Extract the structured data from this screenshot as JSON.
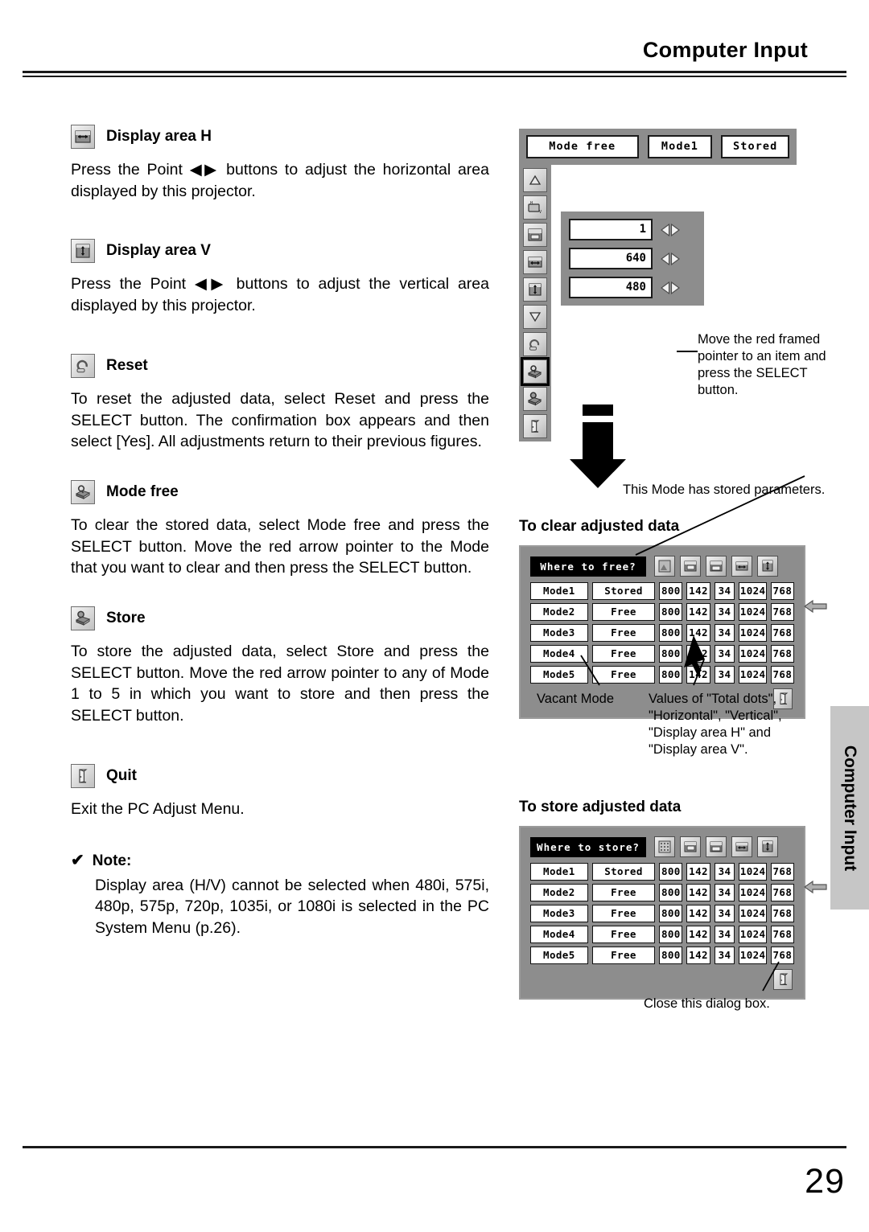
{
  "header": {
    "title": "Computer Input"
  },
  "footer": {
    "page_number": "29"
  },
  "side_tab": {
    "label": "Computer Input"
  },
  "sections": [
    {
      "icon": "display-area-h-icon",
      "title": "Display area H",
      "body": "Press the Point ◀▶ buttons to adjust the horizontal area displayed by this projector."
    },
    {
      "icon": "display-area-v-icon",
      "title": "Display area V",
      "body": "Press the Point ◀▶ buttons to adjust the vertical area displayed by this projector."
    },
    {
      "icon": "reset-icon",
      "title": "Reset",
      "body": "To reset the adjusted data, select Reset and press the SELECT button.  The confirmation box appears and then select [Yes].  All adjustments return to their previous figures."
    },
    {
      "icon": "mode-free-icon",
      "title": "Mode free",
      "body": "To clear the stored data, select Mode free and press the SELECT button.  Move the red arrow pointer to the Mode that you want to clear and then press the SELECT button."
    },
    {
      "icon": "store-icon",
      "title": "Store",
      "body": "To store the adjusted data, select Store and press the SELECT button.  Move the red arrow pointer to any of Mode 1 to 5 in which you want to store and then press the SELECT button."
    },
    {
      "icon": "quit-icon",
      "title": "Quit",
      "body": "Exit the PC Adjust Menu."
    }
  ],
  "note": {
    "check_glyph": "✔",
    "title": "Note:",
    "body": "Display area (H/V) cannot be selected when 480i, 575i, 480p, 575p, 720p, 1035i, or 1080i is selected in the PC System Menu (p.26)."
  },
  "osd": {
    "top_fields": [
      {
        "name": "mode-free-field",
        "value": "Mode free"
      },
      {
        "name": "mode-number-field",
        "value": "Mode1"
      },
      {
        "name": "stored-state-field",
        "value": "Stored"
      }
    ],
    "rail_icons": [
      "fine-sync-icon",
      "total-dots-icon",
      "horizontal-icon",
      "vertical-icon",
      "display-area-h-icon",
      "display-area-v-icon",
      "reset-icon",
      "mode-free-icon",
      "store-icon",
      "quit-icon"
    ],
    "selected_rail_index": 7,
    "values": [
      {
        "name": "mode-value",
        "value": "1"
      },
      {
        "name": "display-area-h-value",
        "value": "640"
      },
      {
        "name": "display-area-v-value",
        "value": "480"
      }
    ],
    "callout": "Move the red framed pointer to an item and press the SELECT button."
  },
  "stored_caption": "This Mode has stored parameters.",
  "clear_block": {
    "heading": "To clear adjusted data",
    "dialog": {
      "question": "Where to free?",
      "header_icons": [
        "fine-sync-icon",
        "total-dots-icon",
        "horizontal-icon",
        "display-area-h-icon",
        "display-area-v-icon"
      ],
      "rows": [
        {
          "mode": "Mode1",
          "state": "Stored",
          "total_dots": "800",
          "horizontal": "142",
          "vertical": "34",
          "display_area_h": "1024",
          "display_area_v": "768"
        },
        {
          "mode": "Mode2",
          "state": "Free",
          "total_dots": "800",
          "horizontal": "142",
          "vertical": "34",
          "display_area_h": "1024",
          "display_area_v": "768"
        },
        {
          "mode": "Mode3",
          "state": "Free",
          "total_dots": "800",
          "horizontal": "142",
          "vertical": "34",
          "display_area_h": "1024",
          "display_area_v": "768"
        },
        {
          "mode": "Mode4",
          "state": "Free",
          "total_dots": "800",
          "horizontal": "142",
          "vertical": "34",
          "display_area_h": "1024",
          "display_area_v": "768"
        },
        {
          "mode": "Mode5",
          "state": "Free",
          "total_dots": "800",
          "horizontal": "142",
          "vertical": "34",
          "display_area_h": "1024",
          "display_area_v": "768"
        }
      ],
      "quit_icon": "quit-icon",
      "row_pointer_icon": "left-arrow-pointer-icon"
    },
    "label_vacant": "Vacant Mode",
    "label_values": "Values of \"Total dots\", \"Horizontal\", \"Vertical\", \"Display area H\" and \"Display area V\"."
  },
  "store_block": {
    "heading": "To store adjusted data",
    "dialog": {
      "question": "Where to store?",
      "header_icons": [
        "fine-sync-icon",
        "total-dots-icon",
        "horizontal-icon",
        "display-area-h-icon",
        "display-area-v-icon"
      ],
      "rows": [
        {
          "mode": "Mode1",
          "state": "Stored",
          "total_dots": "800",
          "horizontal": "142",
          "vertical": "34",
          "display_area_h": "1024",
          "display_area_v": "768"
        },
        {
          "mode": "Mode2",
          "state": "Free",
          "total_dots": "800",
          "horizontal": "142",
          "vertical": "34",
          "display_area_h": "1024",
          "display_area_v": "768"
        },
        {
          "mode": "Mode3",
          "state": "Free",
          "total_dots": "800",
          "horizontal": "142",
          "vertical": "34",
          "display_area_h": "1024",
          "display_area_v": "768"
        },
        {
          "mode": "Mode4",
          "state": "Free",
          "total_dots": "800",
          "horizontal": "142",
          "vertical": "34",
          "display_area_h": "1024",
          "display_area_v": "768"
        },
        {
          "mode": "Mode5",
          "state": "Free",
          "total_dots": "800",
          "horizontal": "142",
          "vertical": "34",
          "display_area_h": "1024",
          "display_area_v": "768"
        }
      ],
      "quit_icon": "quit-icon",
      "row_pointer_icon": "left-arrow-pointer-icon"
    },
    "label_close": "Close this dialog box."
  },
  "colors": {
    "osd_gray": "#8d8d8d",
    "tab_gray": "#c6c6c6",
    "ink": "#000000"
  }
}
